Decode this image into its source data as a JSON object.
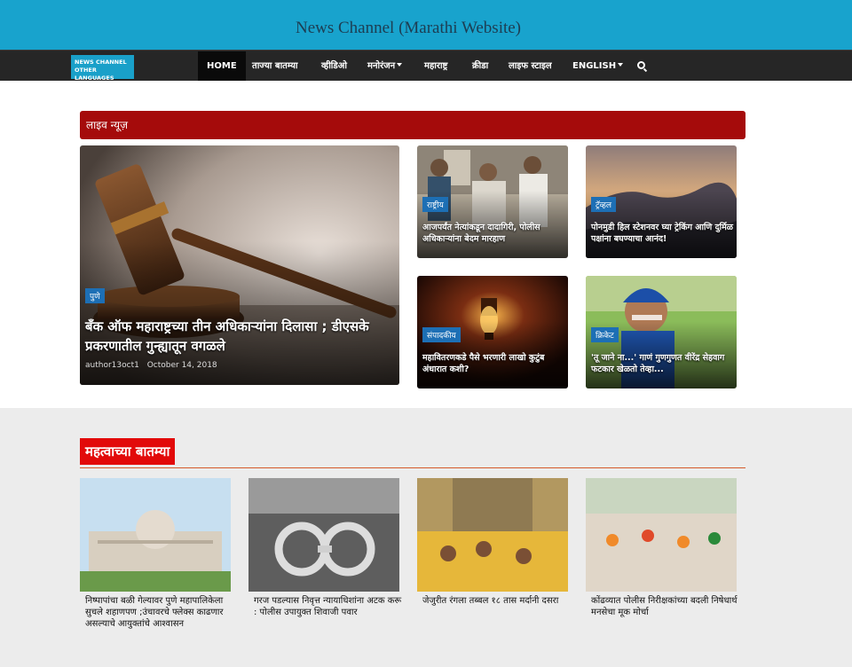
{
  "site": {
    "title": "News Channel (Marathi Website)",
    "lang_logo": [
      "NEWS CHANNEL",
      "OTHER LANGUAGES"
    ]
  },
  "nav": [
    {
      "label": "HOME",
      "active": true
    },
    {
      "label": "ताज्या बातम्या"
    },
    {
      "label": "व्हीडिओ"
    },
    {
      "label": "मनोरंजन",
      "dropdown": true
    },
    {
      "label": "महाराष्ट्र"
    },
    {
      "label": "क्रीडा"
    },
    {
      "label": "लाइफ स्टाइल"
    },
    {
      "label": "ENGLISH",
      "dropdown": true
    }
  ],
  "live": {
    "heading": "लाइव न्यूज़",
    "main": {
      "category": "पुणे",
      "title": "बँक ऑफ महाराष्ट्रच्या तीन अधिकाऱ्यांना दिलासा ; डीएसके प्रकरणातील गुन्ह्यातून वगळले",
      "author": "author13oct1",
      "date": "October 14, 2018"
    },
    "cards": [
      {
        "category": "राष्ट्रीय",
        "title": "आजपर्यंत नेत्यांकडून दादागिरी, पोलीस अधिकाऱ्यांना बेदम मारहाण"
      },
      {
        "category": "ट्रॅव्हल",
        "title": "पोनमुडी हिल स्टेशनवर घ्या ट्रेकिंग आणि दुर्मिळ पक्षांना बघण्याचा आनंद!"
      },
      {
        "category": "संपादकीय",
        "title": "महावितरणकडे पैसे भरणारी लाखो कुटुंब अंधारात कशी?"
      },
      {
        "category": "क्रिकेट",
        "title": "'तू जाने ना...' गाणं गुणगुणत वीरेंद्र सेहवाग फटकार खेळतो तेव्हा..."
      }
    ]
  },
  "important": {
    "heading": "महत्वाच्या बातम्या",
    "items": [
      {
        "title": "निष्पापांचा बळी गेल्यावर पुणे महापालिकेला सुचले शहाणपण ;उंचावरचे फ्लेक्स काढणार असल्याचे आयुक्तांचे आश्वासन"
      },
      {
        "title": "गरज पडल्यास निवृत्त न्यायाधिशांना अटक करू : पोलीस उपायुक्त शिवाजी पवार"
      },
      {
        "title": "जेजुरीत रंगला तब्बल १८ तास मर्दानी दसरा"
      },
      {
        "title": "कोंढव्यात पोलीस निरीक्षकांच्या बदली निषेधार्थ मनसेचा मूक मोर्चा"
      }
    ]
  },
  "colors": {
    "topbar": "#18a3cd",
    "navbar": "#262626",
    "live_bar": "#a50b0b",
    "section_head": "#e20a0a",
    "category": "#1d6fb5"
  }
}
